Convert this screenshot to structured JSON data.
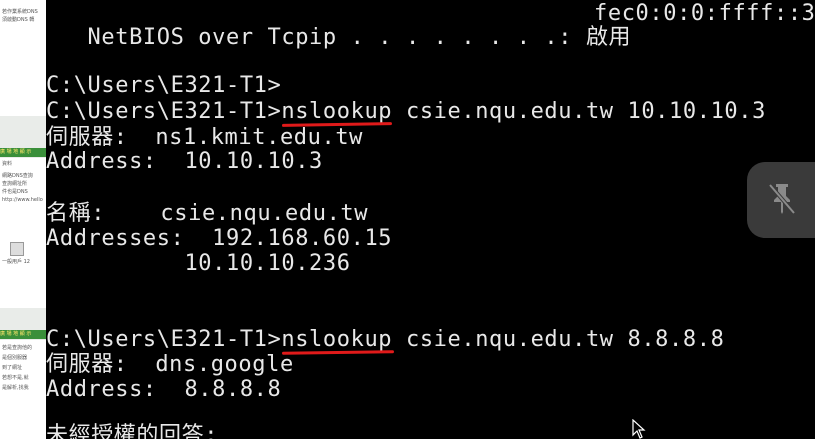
{
  "left_panel": {
    "bar_1": "廣  場  地  顯  示",
    "snippet_1": [
      "若作業系統DNS",
      "須啟動DNS 轉"
    ],
    "bar_2": "廣  場  地  顯  示",
    "snippet_2": [
      "資料",
      "網路DNS查詢",
      "查詢網址所",
      "件也是DNS",
      "http://www.hello"
    ],
    "user_label": "一般用戶",
    "user_count": "12",
    "bar_3": "廣  場  地  顯  示",
    "snippet_3": [
      "若是查詢他的",
      "是個別服器",
      "到了網址",
      "若想不是,就",
      "是解析,找我"
    ]
  },
  "terminal": {
    "lines": [
      "fec0:0:0:ffff::3",
      "   NetBIOS over Tcpip . . . . . . . .: 啟用",
      "",
      "C:\\Users\\E321-T1>",
      "C:\\Users\\E321-T1>nslookup csie.nqu.edu.tw 10.10.10.3",
      "伺服器:  ns1.kmit.edu.tw",
      "Address:  10.10.10.3",
      "",
      "名稱:    csie.nqu.edu.tw",
      "Addresses:  192.168.60.15",
      "          10.10.10.236",
      "",
      "",
      "C:\\Users\\E321-T1>nslookup csie.nqu.edu.tw 8.8.8.8",
      "伺服器:  dns.google",
      "Address:  8.8.8.8",
      "",
      "未經授權的回答:"
    ]
  },
  "overlay": {
    "pin_icon": "unpin-icon",
    "annotation_color": "#e01a1a"
  }
}
